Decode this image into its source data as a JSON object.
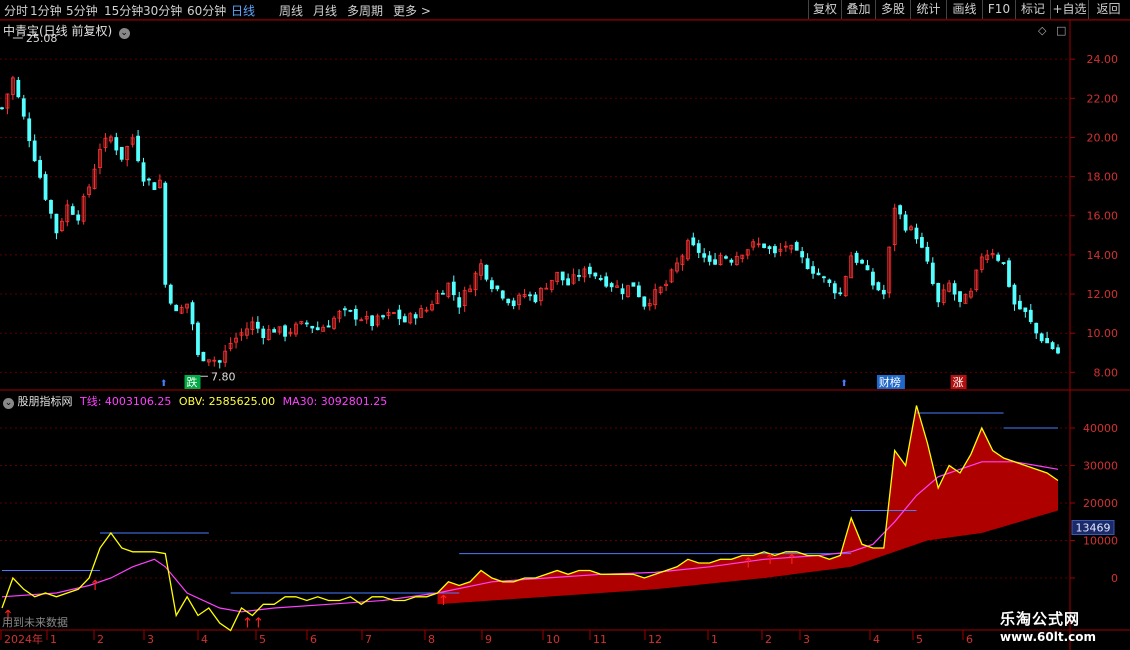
{
  "toolbar": {
    "periods": [
      "分时",
      "1分钟",
      "5分钟",
      "15分钟",
      "30分钟",
      "60分钟",
      "日线",
      "周线",
      "月线",
      "多周期",
      "更多 >"
    ],
    "active_period": "日线",
    "buttons": [
      "复权",
      "叠加",
      "多股",
      "统计",
      "画线",
      "F10",
      "标记",
      "+自选",
      "返回"
    ]
  },
  "price_panel": {
    "title": "中青宝(日线 前复权)",
    "high_label": "25.08",
    "low_label": "7.80",
    "axis_ticks": [
      "24.00",
      "22.00",
      "20.00",
      "18.00",
      "16.00",
      "14.00",
      "12.00",
      "10.00",
      "8.00"
    ],
    "markers": [
      {
        "text": "跌",
        "color": "#00aa44"
      },
      {
        "text": "财榜",
        "color": "#1e66c8"
      },
      {
        "text": "涨",
        "color": "#b01010"
      }
    ],
    "colors": {
      "up": "#ff3232",
      "down": "#54ffff",
      "grid": "#5a0000",
      "border": "#a00000"
    }
  },
  "indicator_panel": {
    "name": "股朋指标网",
    "t_line_label": "T线: 4003106.25",
    "obv_label": "OBV: 2585625.00",
    "ma30_label": "MA30: 3092801.25",
    "axis_ticks": [
      "40000",
      "30000",
      "20000",
      "10000",
      "0"
    ],
    "current_value": "13469",
    "footnote": "用到未来数据",
    "colors": {
      "obv": "#ffff00",
      "ma30": "#ff40ff",
      "t_line": "#ff00ff",
      "fill": "#b80000",
      "stair": "#4a7cff",
      "signal": "#ff2020"
    }
  },
  "time_axis": {
    "labels": [
      "2024年",
      "1",
      "2",
      "3",
      "4",
      "5",
      "6",
      "7",
      "8",
      "9",
      "10",
      "11",
      "12",
      "1",
      "2",
      "3",
      "4",
      "5",
      "6"
    ]
  },
  "watermark": {
    "name": "乐淘公式网",
    "url": "www.60lt.com"
  },
  "chart_data": [
    {
      "type": "candlestick",
      "title": "中青宝(日线 前复权)",
      "ylim": [
        7.2,
        26.0
      ],
      "yticks": [
        24,
        22,
        20,
        18,
        16,
        14,
        12,
        10,
        8
      ],
      "annotations": {
        "max": 25.08,
        "min": 7.8
      },
      "close_path": [
        [
          0,
          21.5
        ],
        [
          2,
          23.0
        ],
        [
          4,
          21.0
        ],
        [
          6,
          19.0
        ],
        [
          8,
          17.0
        ],
        [
          10,
          15.2
        ],
        [
          12,
          16.5
        ],
        [
          14,
          16.0
        ],
        [
          16,
          17.5
        ],
        [
          18,
          19.5
        ],
        [
          20,
          20.0
        ],
        [
          22,
          19.0
        ],
        [
          24,
          20.0
        ],
        [
          26,
          18.0
        ],
        [
          28,
          17.5
        ],
        [
          29,
          17.8
        ],
        [
          30,
          12.5
        ],
        [
          32,
          11.0
        ],
        [
          34,
          11.5
        ],
        [
          35,
          10.5
        ],
        [
          36,
          8.8
        ],
        [
          38,
          8.8
        ],
        [
          40,
          8.5
        ],
        [
          42,
          9.5
        ],
        [
          44,
          10.0
        ],
        [
          46,
          10.5
        ],
        [
          48,
          10.0
        ],
        [
          50,
          10.2
        ],
        [
          52,
          10.0
        ],
        [
          54,
          10.3
        ],
        [
          56,
          10.5
        ],
        [
          58,
          10.2
        ],
        [
          60,
          10.5
        ],
        [
          62,
          11.0
        ],
        [
          64,
          11.0
        ],
        [
          66,
          10.8
        ],
        [
          68,
          10.5
        ],
        [
          70,
          10.8
        ],
        [
          72,
          11.0
        ],
        [
          74,
          10.6
        ],
        [
          76,
          11.0
        ],
        [
          78,
          11.2
        ],
        [
          80,
          12.0
        ],
        [
          82,
          12.5
        ],
        [
          84,
          11.5
        ],
        [
          86,
          12.5
        ],
        [
          88,
          13.5
        ],
        [
          90,
          12.5
        ],
        [
          92,
          12.0
        ],
        [
          94,
          11.5
        ],
        [
          96,
          12.0
        ],
        [
          98,
          11.8
        ],
        [
          100,
          12.5
        ],
        [
          102,
          13.0
        ],
        [
          104,
          12.5
        ],
        [
          106,
          13.0
        ],
        [
          108,
          13.2
        ],
        [
          110,
          12.8
        ],
        [
          112,
          12.5
        ],
        [
          114,
          12.2
        ],
        [
          116,
          12.5
        ],
        [
          118,
          11.5
        ],
        [
          120,
          12.0
        ],
        [
          122,
          12.5
        ],
        [
          124,
          13.5
        ],
        [
          126,
          14.5
        ],
        [
          128,
          14.2
        ],
        [
          130,
          13.5
        ],
        [
          132,
          14.0
        ],
        [
          134,
          13.8
        ],
        [
          136,
          14.2
        ],
        [
          138,
          14.5
        ],
        [
          140,
          14.5
        ],
        [
          142,
          14.0
        ],
        [
          144,
          14.5
        ],
        [
          146,
          14.0
        ],
        [
          148,
          13.5
        ],
        [
          150,
          13.0
        ],
        [
          152,
          12.5
        ],
        [
          154,
          12.0
        ],
        [
          156,
          14.0
        ],
        [
          158,
          13.5
        ],
        [
          160,
          12.5
        ],
        [
          162,
          12.0
        ],
        [
          164,
          16.5
        ],
        [
          166,
          15.5
        ],
        [
          168,
          15.0
        ],
        [
          170,
          13.5
        ],
        [
          172,
          11.5
        ],
        [
          174,
          12.5
        ],
        [
          176,
          11.5
        ],
        [
          178,
          12.0
        ],
        [
          180,
          14.0
        ],
        [
          182,
          14.2
        ],
        [
          184,
          13.5
        ],
        [
          186,
          11.5
        ],
        [
          188,
          11.0
        ],
        [
          190,
          10.0
        ],
        [
          192,
          9.5
        ],
        [
          194,
          9.0
        ]
      ]
    },
    {
      "type": "line",
      "title": "股朋指标网",
      "ylim": [
        -8000,
        48000
      ],
      "yticks": [
        40000,
        30000,
        20000,
        10000,
        0
      ],
      "series": [
        {
          "name": "OBV",
          "values": [
            [
              0,
              -8000
            ],
            [
              2,
              0
            ],
            [
              4,
              -3000
            ],
            [
              6,
              -5000
            ],
            [
              8,
              -4000
            ],
            [
              10,
              -5000
            ],
            [
              12,
              -4000
            ],
            [
              14,
              -3000
            ],
            [
              16,
              0
            ],
            [
              18,
              8000
            ],
            [
              20,
              12000
            ],
            [
              22,
              8000
            ],
            [
              24,
              7000
            ],
            [
              26,
              7000
            ],
            [
              28,
              7000
            ],
            [
              30,
              6500
            ],
            [
              32,
              -10000
            ],
            [
              34,
              -5000
            ],
            [
              36,
              -10000
            ],
            [
              38,
              -8000
            ],
            [
              40,
              -12000
            ],
            [
              42,
              -14000
            ],
            [
              44,
              -8000
            ],
            [
              46,
              -10000
            ],
            [
              48,
              -7000
            ],
            [
              50,
              -7000
            ],
            [
              52,
              -5000
            ],
            [
              54,
              -5000
            ],
            [
              56,
              -6000
            ],
            [
              58,
              -5000
            ],
            [
              60,
              -6000
            ],
            [
              62,
              -6000
            ],
            [
              64,
              -5000
            ],
            [
              66,
              -7000
            ],
            [
              68,
              -5000
            ],
            [
              70,
              -5000
            ],
            [
              72,
              -6000
            ],
            [
              74,
              -6000
            ],
            [
              76,
              -5000
            ],
            [
              78,
              -5000
            ],
            [
              80,
              -4000
            ],
            [
              82,
              -1000
            ],
            [
              84,
              -2000
            ],
            [
              86,
              -1000
            ],
            [
              88,
              2000
            ],
            [
              90,
              0
            ],
            [
              92,
              -1000
            ],
            [
              94,
              -1000
            ],
            [
              96,
              0
            ],
            [
              98,
              0
            ],
            [
              100,
              1000
            ],
            [
              102,
              2000
            ],
            [
              104,
              1000
            ],
            [
              106,
              2000
            ],
            [
              108,
              2000
            ],
            [
              110,
              1000
            ],
            [
              112,
              1000
            ],
            [
              114,
              1000
            ],
            [
              116,
              1000
            ],
            [
              118,
              0
            ],
            [
              120,
              1000
            ],
            [
              122,
              2000
            ],
            [
              124,
              3000
            ],
            [
              126,
              5000
            ],
            [
              128,
              4000
            ],
            [
              130,
              4000
            ],
            [
              132,
              5000
            ],
            [
              134,
              5000
            ],
            [
              136,
              6000
            ],
            [
              138,
              6000
            ],
            [
              140,
              7000
            ],
            [
              142,
              6000
            ],
            [
              144,
              7000
            ],
            [
              146,
              7000
            ],
            [
              148,
              6000
            ],
            [
              150,
              6000
            ],
            [
              152,
              5000
            ],
            [
              154,
              6000
            ],
            [
              156,
              16000
            ],
            [
              158,
              9000
            ],
            [
              160,
              8000
            ],
            [
              162,
              8000
            ],
            [
              164,
              34000
            ],
            [
              166,
              30000
            ],
            [
              168,
              46000
            ],
            [
              170,
              36000
            ],
            [
              172,
              24000
            ],
            [
              174,
              30000
            ],
            [
              176,
              28000
            ],
            [
              178,
              33000
            ],
            [
              180,
              40000
            ],
            [
              182,
              34000
            ],
            [
              184,
              32000
            ],
            [
              186,
              31000
            ],
            [
              188,
              30000
            ],
            [
              190,
              29000
            ],
            [
              192,
              28000
            ],
            [
              194,
              26000
            ]
          ]
        },
        {
          "name": "MA30",
          "values": [
            [
              0,
              -5000
            ],
            [
              10,
              -4000
            ],
            [
              16,
              -2000
            ],
            [
              20,
              0
            ],
            [
              24,
              3000
            ],
            [
              28,
              5000
            ],
            [
              30,
              3000
            ],
            [
              34,
              -4000
            ],
            [
              40,
              -8000
            ],
            [
              44,
              -9000
            ],
            [
              50,
              -8000
            ],
            [
              60,
              -7000
            ],
            [
              70,
              -6000
            ],
            [
              80,
              -4000
            ],
            [
              90,
              -1000
            ],
            [
              100,
              0
            ],
            [
              110,
              1000
            ],
            [
              120,
              1500
            ],
            [
              130,
              3000
            ],
            [
              140,
              5000
            ],
            [
              150,
              6000
            ],
            [
              156,
              7000
            ],
            [
              160,
              9000
            ],
            [
              164,
              15000
            ],
            [
              168,
              22000
            ],
            [
              172,
              27000
            ],
            [
              176,
              29000
            ],
            [
              180,
              31000
            ],
            [
              186,
              31000
            ],
            [
              190,
              30000
            ],
            [
              194,
              29000
            ]
          ]
        },
        {
          "name": "T线",
          "values": [
            [
              80,
              -7000
            ],
            [
              100,
              -5000
            ],
            [
              120,
              -3000
            ],
            [
              140,
              0
            ],
            [
              156,
              3000
            ],
            [
              160,
              5000
            ],
            [
              164,
              7000
            ],
            [
              170,
              10000
            ],
            [
              180,
              12000
            ],
            [
              194,
              18000
            ]
          ]
        }
      ],
      "stair_levels": [
        {
          "from": 0,
          "to": 18,
          "value": 2000
        },
        {
          "from": 18,
          "to": 38,
          "value": 12000
        },
        {
          "from": 42,
          "to": 84,
          "value": -4000
        },
        {
          "from": 84,
          "to": 156,
          "value": 6500
        },
        {
          "from": 156,
          "to": 168,
          "value": 18000
        },
        {
          "from": 168,
          "to": 184,
          "value": 44000
        },
        {
          "from": 184,
          "to": 194,
          "value": 40000
        }
      ]
    }
  ]
}
